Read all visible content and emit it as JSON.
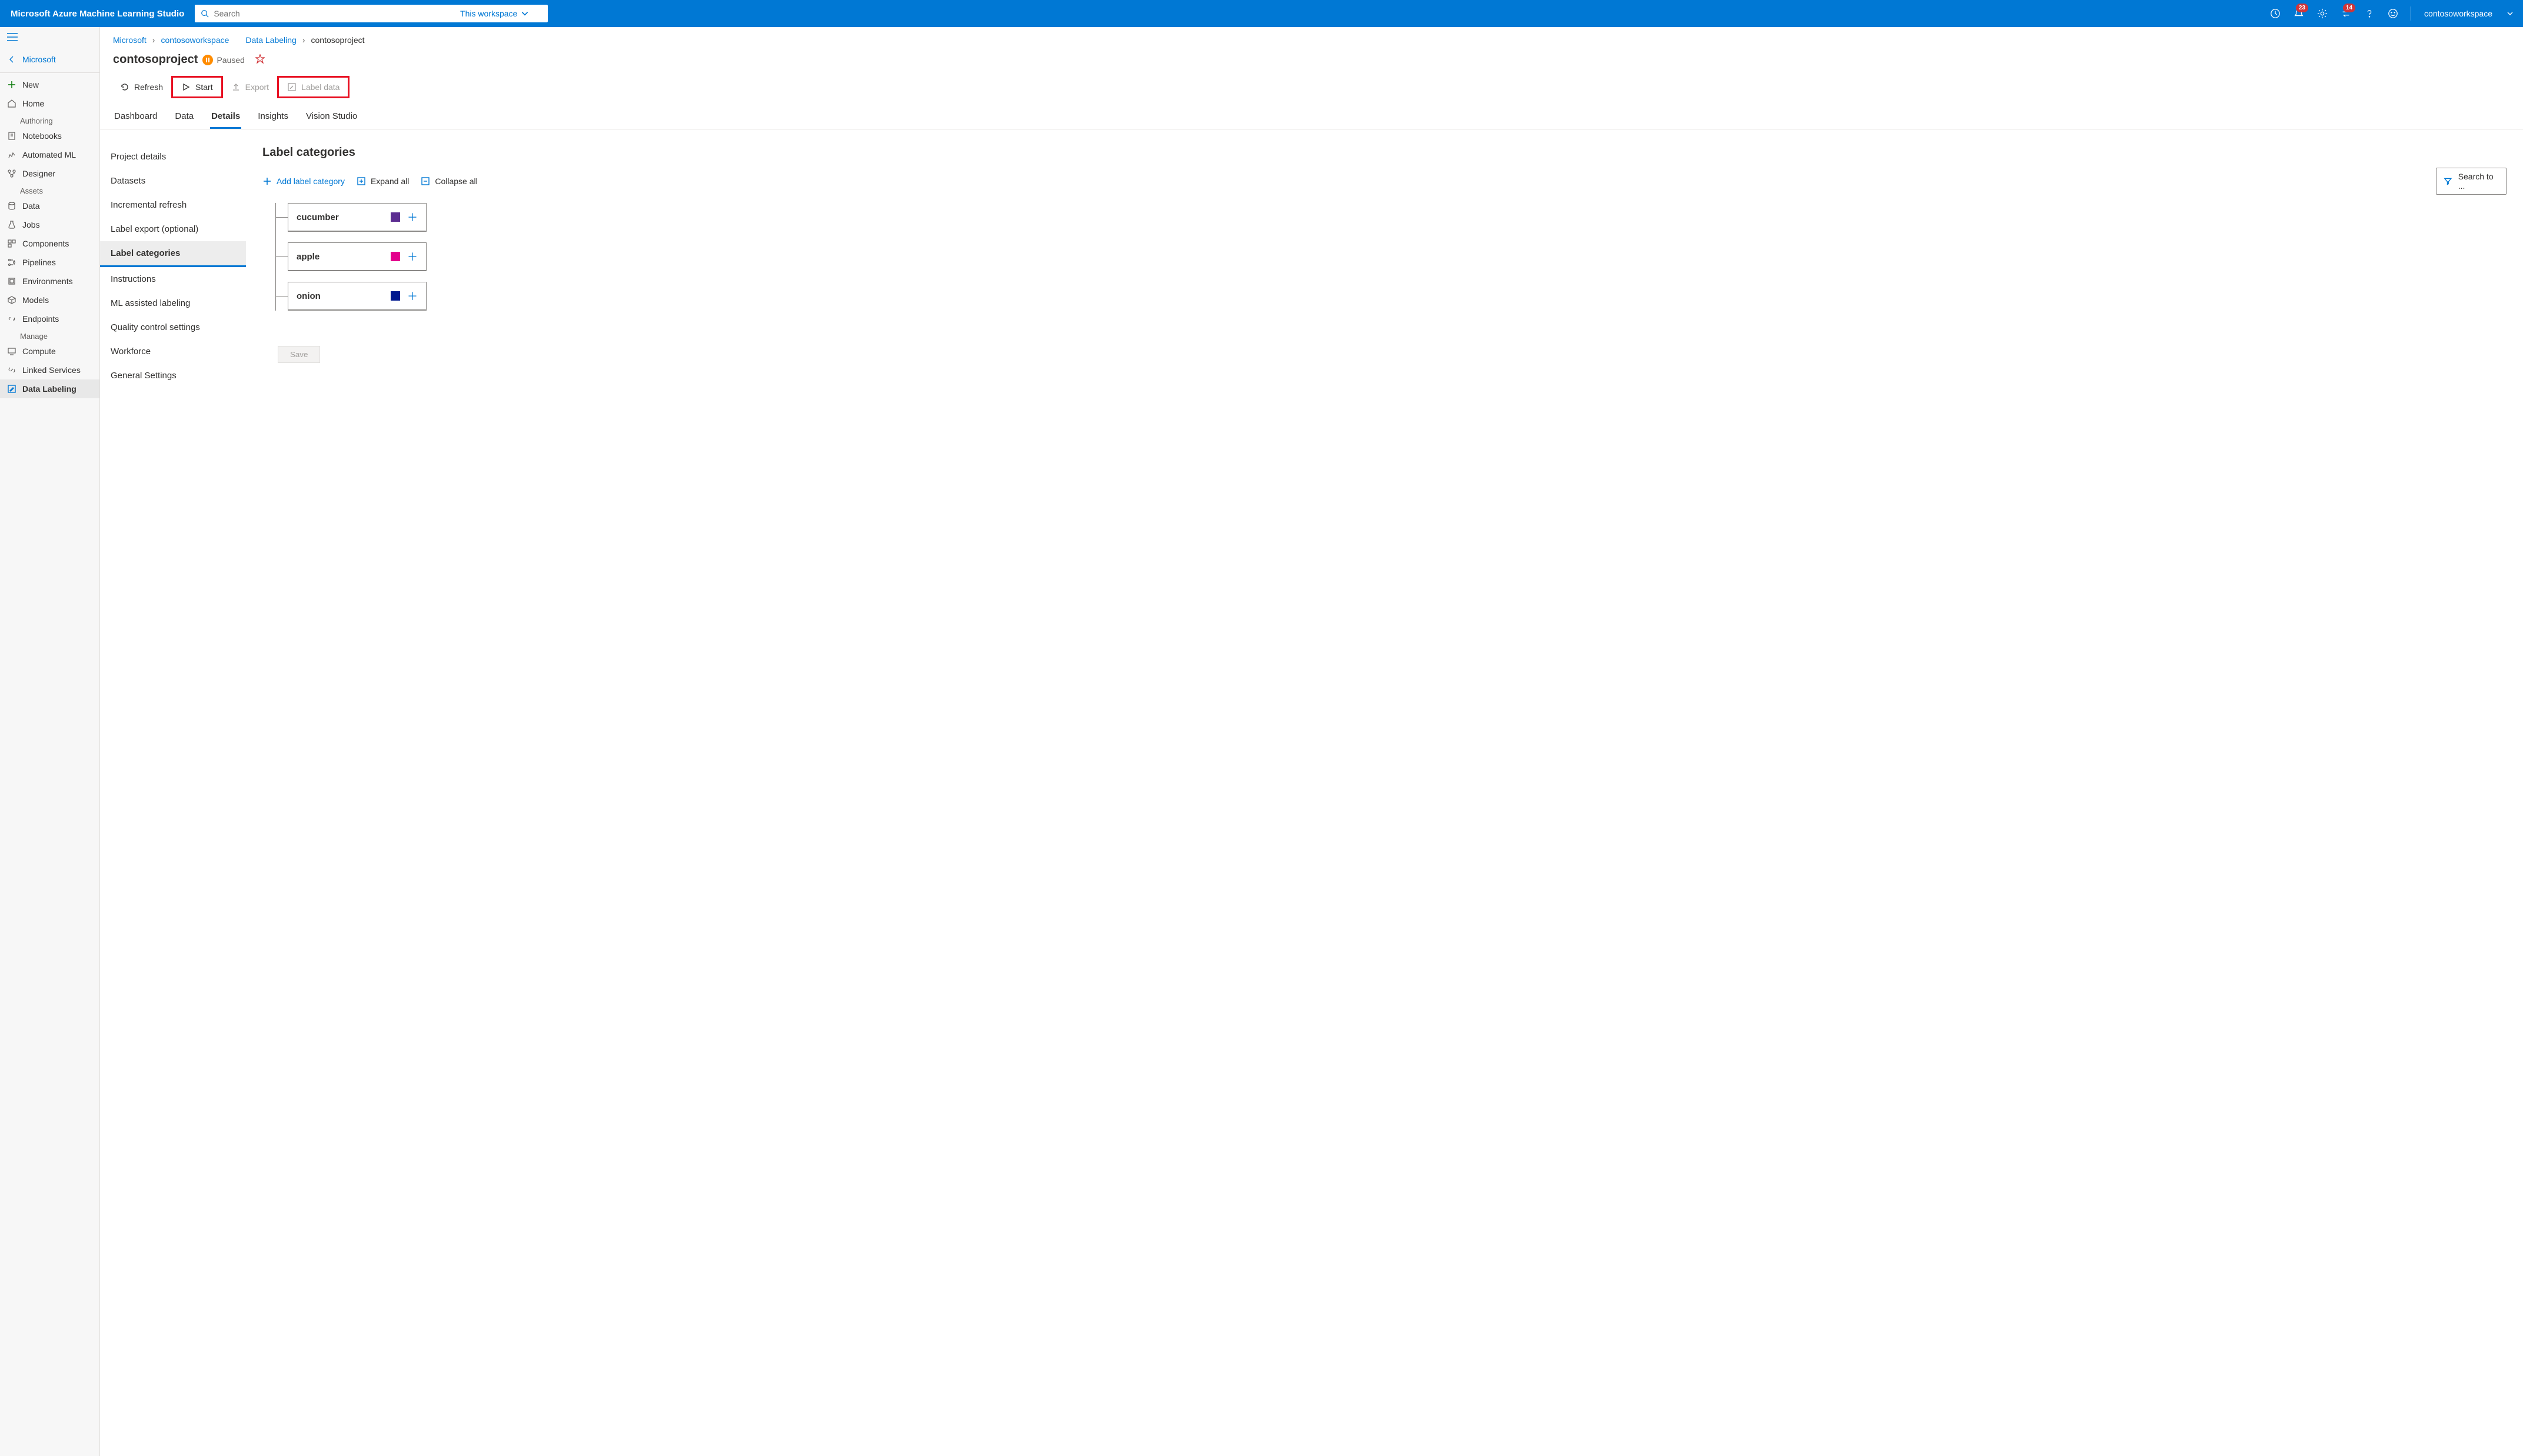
{
  "topbar": {
    "brand": "Microsoft Azure Machine Learning Studio",
    "search_placeholder": "Search",
    "scope": "This workspace",
    "notifications_badge": "23",
    "directories_badge": "14",
    "workspace": "contosoworkspace"
  },
  "sidebar": {
    "back_label": "Microsoft",
    "new": "New",
    "home": "Home",
    "section_authoring": "Authoring",
    "notebooks": "Notebooks",
    "automl": "Automated ML",
    "designer": "Designer",
    "section_assets": "Assets",
    "data": "Data",
    "jobs": "Jobs",
    "components": "Components",
    "pipelines": "Pipelines",
    "environments": "Environments",
    "models": "Models",
    "endpoints": "Endpoints",
    "section_manage": "Manage",
    "compute": "Compute",
    "linked": "Linked Services",
    "labeling": "Data Labeling"
  },
  "breadcrumbs": {
    "a": "Microsoft",
    "b": "contosoworkspace",
    "c": "Data Labeling",
    "d": "contosoproject"
  },
  "header": {
    "title": "contosoproject",
    "status": "Paused"
  },
  "toolbar": {
    "refresh": "Refresh",
    "start": "Start",
    "export": "Export",
    "label_data": "Label data"
  },
  "tabs": {
    "dashboard": "Dashboard",
    "data": "Data",
    "details": "Details",
    "insights": "Insights",
    "vision": "Vision Studio"
  },
  "subnav": {
    "project_details": "Project details",
    "datasets": "Datasets",
    "incremental": "Incremental refresh",
    "export": "Label export (optional)",
    "categories": "Label categories",
    "instructions": "Instructions",
    "ml_assist": "ML assisted labeling",
    "qc": "Quality control settings",
    "workforce": "Workforce",
    "general": "General Settings"
  },
  "content": {
    "heading": "Label categories",
    "add": "Add label category",
    "expand": "Expand all",
    "collapse": "Collapse all",
    "search": "Search to ...",
    "labels": [
      {
        "name": "cucumber",
        "color": "#5c2d91"
      },
      {
        "name": "apple",
        "color": "#e3008c"
      },
      {
        "name": "onion",
        "color": "#00188f"
      }
    ],
    "save": "Save"
  }
}
